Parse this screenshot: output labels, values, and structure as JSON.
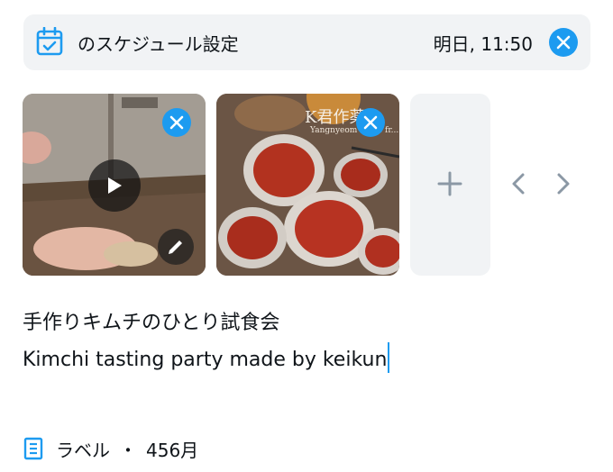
{
  "schedule": {
    "label": "のスケジュール設定",
    "time": "明日, 11:50",
    "icon": "calendar-icon"
  },
  "media": {
    "watermark_title": "K君作薬",
    "watermark_subtitle": "Yangnyeom made fr...",
    "add_icon": "plus-icon"
  },
  "post": {
    "title": "手作りキムチのひとり試食会",
    "body": "Kimchi tasting party made by keikun"
  },
  "label_row": {
    "label": "ラベル",
    "separator": "・",
    "count": "456月",
    "icon": "building-icon"
  },
  "colors": {
    "accent": "#1d9bf0",
    "panel": "#f1f3f5",
    "icon_gray": "#8b98a5"
  }
}
